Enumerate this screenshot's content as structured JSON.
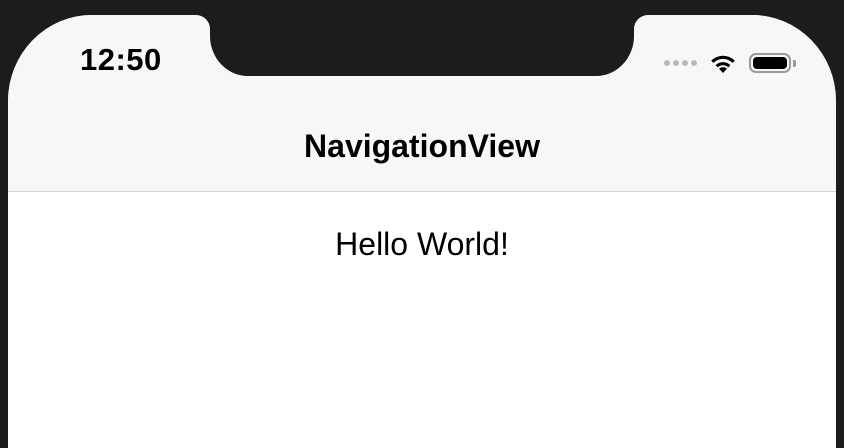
{
  "status_bar": {
    "time": "12:50",
    "signal_icon": "signal-dots-icon",
    "wifi_icon": "wifi-icon",
    "battery_icon": "battery-icon",
    "battery_level": 1.0
  },
  "navigation": {
    "title": "NavigationView"
  },
  "content": {
    "text": "Hello World!"
  },
  "colors": {
    "nav_background": "#f7f7f7",
    "content_background": "#ffffff",
    "bezel": "#1c1c1c",
    "separator": "#d2d2d4"
  }
}
